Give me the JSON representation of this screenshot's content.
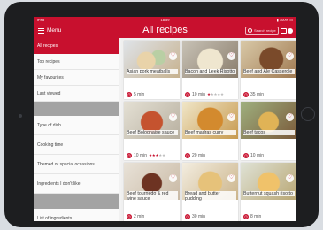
{
  "status": {
    "carrier": "iPad",
    "time": "18:59",
    "battery": "▮ 100% ▭"
  },
  "navbar": {
    "menu_label": "Menu",
    "title": "All recipes",
    "search_placeholder": "Search recipe"
  },
  "sidebar": {
    "items": [
      "All recipes",
      "Top recipes",
      "My favourites",
      "Last viewed",
      "Type of dish",
      "Cooking time",
      "Themed or special occasions",
      "Ingredients I don't like",
      "List of ingredients"
    ]
  },
  "recipes": [
    {
      "title": "Asian pork meatballs",
      "time": "5 min",
      "rating": 0
    },
    {
      "title": "Bacon and Leek Risotto",
      "time": "10 min",
      "rating": 1
    },
    {
      "title": "Beef and Ale Casserole",
      "time": "35 min",
      "rating": 0
    },
    {
      "title": "Beef Bolognaise sauce",
      "time": "10 min",
      "rating": 3
    },
    {
      "title": "Beef madras curry",
      "time": "20 min",
      "rating": 0
    },
    {
      "title": "Beef tacos",
      "time": "10 min",
      "rating": 0
    },
    {
      "title": "Beef tournedo & red wine sauce",
      "time": "2 min",
      "rating": 0
    },
    {
      "title": "Bread and butter pudding",
      "time": "30 min",
      "rating": 0
    },
    {
      "title": "Butternut squash risotto",
      "time": "8 min",
      "rating": 0
    }
  ],
  "colors": {
    "accent": "#c8102e",
    "sidebar_gap": "#a3a3a3"
  },
  "icons": {
    "menu": "hamburger-icon",
    "search": "search-icon",
    "view_toggle": "view-toggle-icon",
    "favorite": "heart-icon",
    "time": "clock-icon",
    "rating": "star-icon"
  }
}
